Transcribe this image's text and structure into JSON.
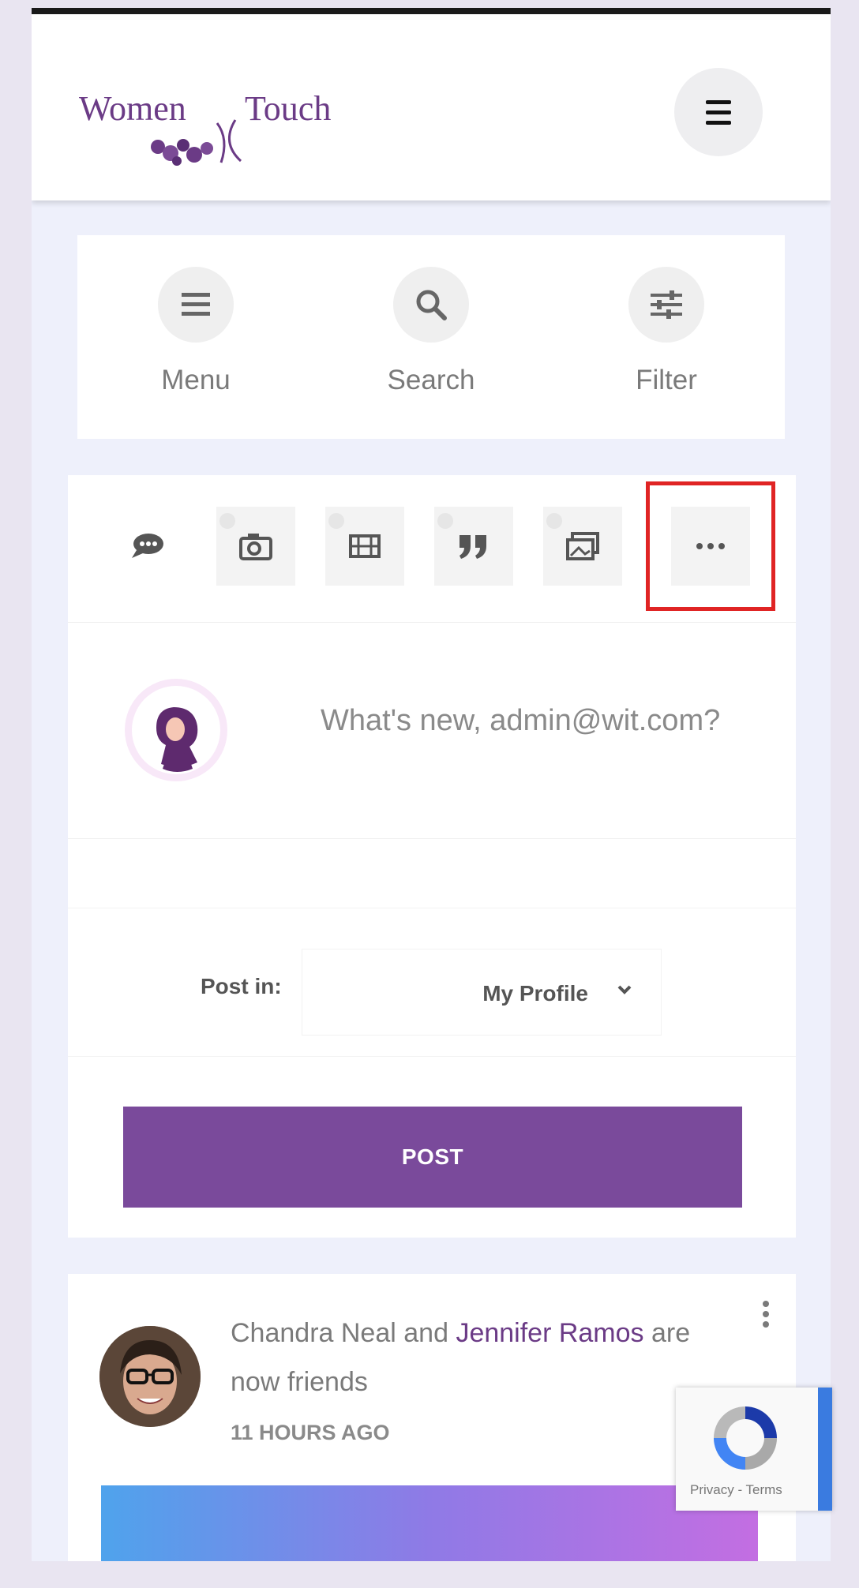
{
  "header": {
    "logo_word_1": "Women",
    "logo_word_2": "Touch",
    "menu_button_icon": "hamburger-icon"
  },
  "quick_actions": [
    {
      "label": "Menu",
      "icon": "menu-icon"
    },
    {
      "label": "Search",
      "icon": "search-icon"
    },
    {
      "label": "Filter",
      "icon": "sliders-icon"
    }
  ],
  "composer": {
    "post_types": [
      {
        "icon": "speech-bubble-icon"
      },
      {
        "icon": "camera-icon"
      },
      {
        "icon": "film-icon"
      },
      {
        "icon": "quote-icon"
      },
      {
        "icon": "image-link-icon"
      },
      {
        "icon": "more-dots-icon",
        "highlighted": true
      }
    ],
    "placeholder": "What's new, admin@wit.com?",
    "post_in_label": "Post in:",
    "post_in_value": "My Profile",
    "post_button": "POST"
  },
  "activity": {
    "user1": "Chandra Neal",
    "connector": "and",
    "user2": "Jennifer Ramos",
    "action": "are now friends",
    "time": "11 HOURS AGO"
  },
  "recaptcha": {
    "footer_text": "Privacy - Terms"
  },
  "colors": {
    "brand_purple": "#7a4a9b",
    "highlight_red": "#e02424",
    "page_bg": "#eef0fb"
  }
}
